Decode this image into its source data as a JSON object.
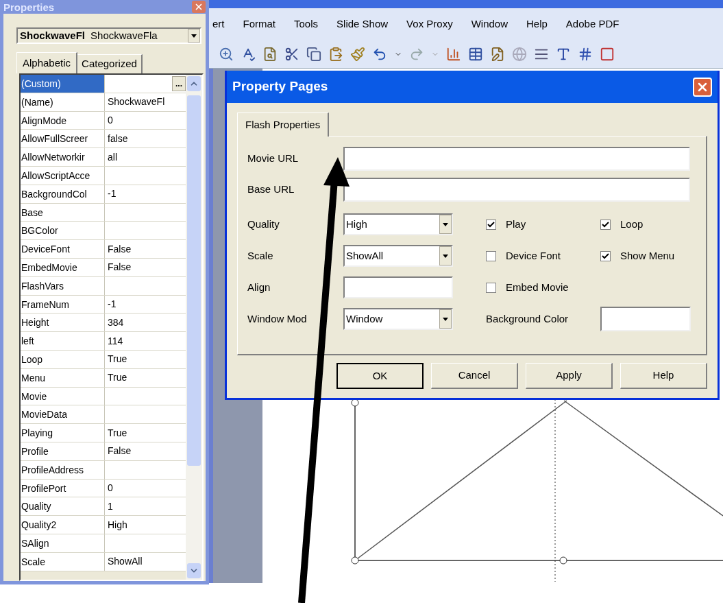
{
  "app": {
    "menu_bar": [
      {
        "label": "ert"
      },
      {
        "label": "Format"
      },
      {
        "label": "Tools"
      },
      {
        "label": "Slide Show"
      },
      {
        "label": "Vox Proxy"
      },
      {
        "label": "Window"
      },
      {
        "label": "Help"
      },
      {
        "label": "Adobe PDF"
      }
    ]
  },
  "properties_panel": {
    "title": "Properties",
    "object_combo": {
      "name": "ShockwaveFl",
      "type": "ShockwaveFla"
    },
    "tabs": [
      {
        "label": "Alphabetic",
        "selected": true
      },
      {
        "label": "Categorized",
        "selected": false
      }
    ],
    "rows": [
      {
        "name": "(Custom)",
        "value": "",
        "selected": true,
        "button": "..."
      },
      {
        "name": "(Name)",
        "value": "ShockwaveFl",
        "selected": false
      },
      {
        "name": "AlignMode",
        "value": "0",
        "selected": false
      },
      {
        "name": "AllowFullScreer",
        "value": "false",
        "selected": false
      },
      {
        "name": "AllowNetworkir",
        "value": "all",
        "selected": false
      },
      {
        "name": "AllowScriptAcce",
        "value": "",
        "selected": false
      },
      {
        "name": "BackgroundCol",
        "value": "-1",
        "selected": false
      },
      {
        "name": "Base",
        "value": "",
        "selected": false
      },
      {
        "name": "BGColor",
        "value": "",
        "selected": false
      },
      {
        "name": "DeviceFont",
        "value": "False",
        "selected": false
      },
      {
        "name": "EmbedMovie",
        "value": "False",
        "selected": false
      },
      {
        "name": "FlashVars",
        "value": "",
        "selected": false
      },
      {
        "name": "FrameNum",
        "value": "-1",
        "selected": false
      },
      {
        "name": "Height",
        "value": "384",
        "selected": false
      },
      {
        "name": "left",
        "value": "114",
        "selected": false
      },
      {
        "name": "Loop",
        "value": "True",
        "selected": false
      },
      {
        "name": "Menu",
        "value": "True",
        "selected": false
      },
      {
        "name": "Movie",
        "value": "",
        "selected": false
      },
      {
        "name": "MovieData",
        "value": "",
        "selected": false
      },
      {
        "name": "Playing",
        "value": "True",
        "selected": false
      },
      {
        "name": "Profile",
        "value": "False",
        "selected": false
      },
      {
        "name": "ProfileAddress",
        "value": "",
        "selected": false
      },
      {
        "name": "ProfilePort",
        "value": "0",
        "selected": false
      },
      {
        "name": "Quality",
        "value": "1",
        "selected": false
      },
      {
        "name": "Quality2",
        "value": "High",
        "selected": false
      },
      {
        "name": "SAlign",
        "value": "",
        "selected": false
      },
      {
        "name": "Scale",
        "value": "ShowAll",
        "selected": false
      }
    ]
  },
  "property_pages": {
    "title": "Property Pages",
    "tabs": [
      {
        "label": "Flash Properties",
        "selected": true
      }
    ],
    "url_fields": [
      {
        "label": "Movie URL"
      },
      {
        "label": "Base URL"
      }
    ],
    "rows": [
      {
        "label": "Quality",
        "control": {
          "kind": "select",
          "value": "High"
        },
        "right": [
          {
            "kind": "checkbox",
            "label": "Play",
            "checked": true
          },
          {
            "kind": "checkbox",
            "label": "Loop",
            "checked": true
          }
        ]
      },
      {
        "label": "Scale",
        "control": {
          "kind": "select",
          "value": "ShowAll"
        },
        "right": [
          {
            "kind": "checkbox",
            "label": "Device Font",
            "checked": false
          },
          {
            "kind": "checkbox",
            "label": "Show Menu",
            "checked": true
          }
        ]
      },
      {
        "label": "Align",
        "control": {
          "kind": "text"
        },
        "right": [
          {
            "kind": "checkbox",
            "label": "Embed Movie",
            "checked": false
          }
        ]
      },
      {
        "label": "Window Mod",
        "control": {
          "kind": "select",
          "value": "Window"
        },
        "right": [
          {
            "kind": "color_field",
            "label": "Background Color"
          }
        ]
      }
    ],
    "buttons": [
      {
        "label": "OK",
        "default": true
      },
      {
        "label": "Cancel",
        "default": false
      },
      {
        "label": "Apply",
        "default": false
      },
      {
        "label": "Help",
        "default": false
      }
    ]
  }
}
